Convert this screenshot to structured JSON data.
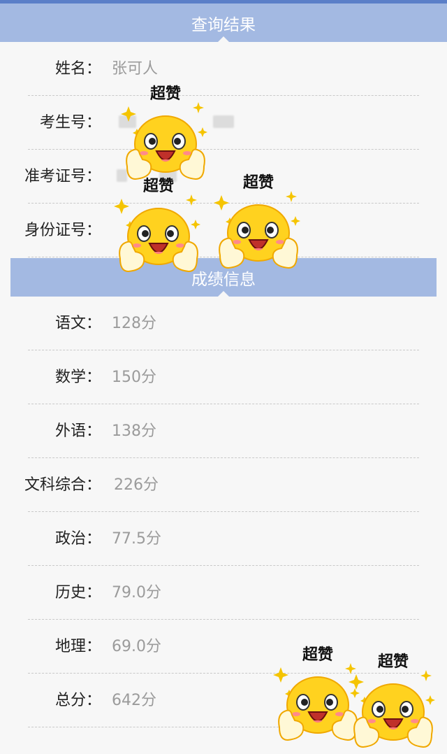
{
  "header_result": "查询结果",
  "header_score": "成绩信息",
  "info": [
    {
      "label": "姓名：",
      "value": "张可人"
    },
    {
      "label": "考生号：",
      "value": ""
    },
    {
      "label": "准考证号：",
      "value": ""
    },
    {
      "label": "身份证号：",
      "value": ""
    }
  ],
  "scores": [
    {
      "label": "语文：",
      "value": "128分"
    },
    {
      "label": "数学：",
      "value": "150分"
    },
    {
      "label": "外语：",
      "value": "138分"
    },
    {
      "label": "文科综合：",
      "value": "226分"
    },
    {
      "label": "政治：",
      "value": "77.5分"
    },
    {
      "label": "历史：",
      "value": "79.0分"
    },
    {
      "label": "地理：",
      "value": "69.0分"
    },
    {
      "label": "总分：",
      "value": "642分"
    }
  ],
  "sticker_caption": "超赞",
  "colors": {
    "header": "#a3b9e2",
    "top_line": "#5b7fc8",
    "emoji_face": "#ffd21f",
    "sparkle": "#f5c400"
  }
}
